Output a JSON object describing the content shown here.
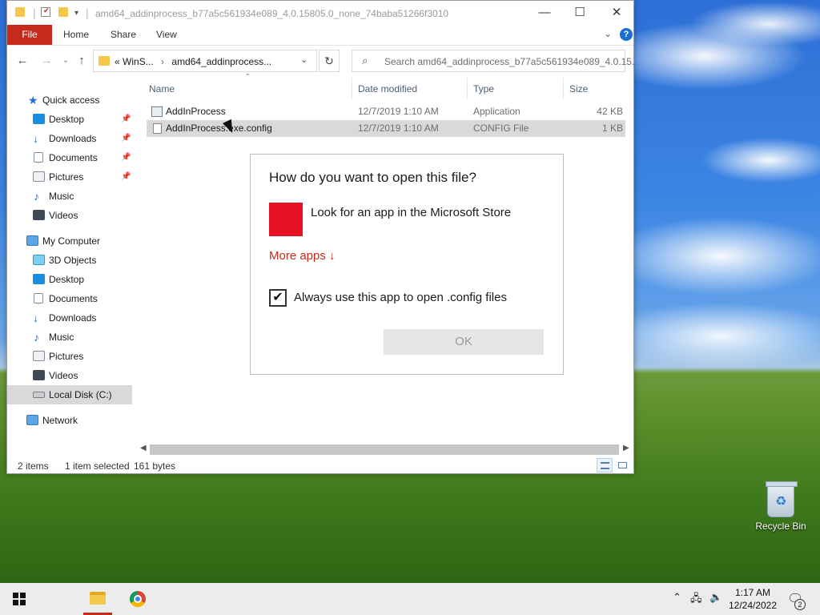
{
  "window": {
    "title": "amd64_addinprocess_b77a5c561934e089_4.0.15805.0_none_74baba51266f3010",
    "minimize": "—",
    "maximize": "☐",
    "close": "✕"
  },
  "ribbon": {
    "file": "File",
    "home": "Home",
    "share": "Share",
    "view": "View",
    "help": "?"
  },
  "navbar": {
    "back": "←",
    "forward": "→",
    "up": "↑",
    "path_prefix": "«",
    "path_parent": "WinS...",
    "path_sep": "›",
    "path_current": "amd64_addinprocess...",
    "refresh": "↻",
    "search_placeholder": "Search amd64_addinprocess_b77a5c561934e089_4.0.15..."
  },
  "sidebar": {
    "items": [
      {
        "label": "Quick access",
        "icon": "star-icon"
      },
      {
        "label": "Desktop",
        "icon": "desktop-icon",
        "pinned": true
      },
      {
        "label": "Downloads",
        "icon": "download-icon",
        "pinned": true
      },
      {
        "label": "Documents",
        "icon": "documents-icon",
        "pinned": true
      },
      {
        "label": "Pictures",
        "icon": "pictures-icon",
        "pinned": true
      },
      {
        "label": "Music",
        "icon": "music-icon"
      },
      {
        "label": "Videos",
        "icon": "videos-icon"
      },
      {
        "label": "My Computer",
        "icon": "computer-icon"
      },
      {
        "label": "3D Objects",
        "icon": "3d-objects-icon"
      },
      {
        "label": "Desktop",
        "icon": "desktop-icon"
      },
      {
        "label": "Documents",
        "icon": "documents-icon"
      },
      {
        "label": "Downloads",
        "icon": "download-icon"
      },
      {
        "label": "Music",
        "icon": "music-icon"
      },
      {
        "label": "Pictures",
        "icon": "pictures-icon"
      },
      {
        "label": "Videos",
        "icon": "videos-icon"
      },
      {
        "label": "Local Disk (C:)",
        "icon": "drive-icon",
        "selected": true
      },
      {
        "label": "Network",
        "icon": "network-icon"
      }
    ]
  },
  "filelist": {
    "columns": [
      "Name",
      "Date modified",
      "Type",
      "Size"
    ],
    "rows": [
      {
        "name": "AddInProcess",
        "date": "12/7/2019 1:10 AM",
        "type": "Application",
        "size": "42 KB"
      },
      {
        "name": "AddInProcess.exe.config",
        "date": "12/7/2019 1:10 AM",
        "type": "CONFIG File",
        "size": "1 KB"
      }
    ]
  },
  "status": {
    "items": "2 items",
    "selected": "1 item selected",
    "size": "161 bytes"
  },
  "dialog": {
    "title": "How do you want to open this file?",
    "store_option": "Look for an app in the Microsoft Store",
    "more_apps": "More apps ↓",
    "always_label": "Always use this app to open .config files",
    "always_checked": "✔",
    "ok": "OK"
  },
  "desktop": {
    "recycle_bin": "Recycle Bin"
  },
  "taskbar": {
    "time": "1:17 AM",
    "date": "12/24/2022",
    "notifications": "2"
  },
  "colors": {
    "accent_red": "#c42b1c",
    "store_red": "#e81123",
    "selection": "#d9d9d9"
  }
}
